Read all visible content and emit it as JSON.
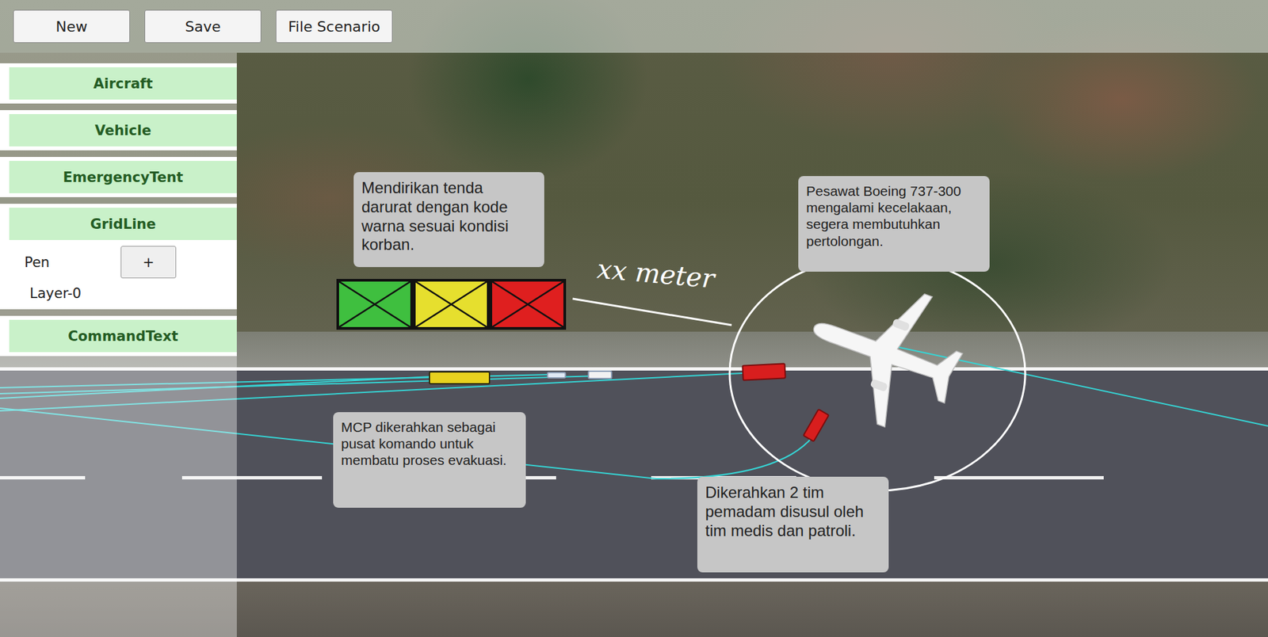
{
  "toolbar": {
    "buttons": [
      "New",
      "Save",
      "File Scenario"
    ]
  },
  "sidebar": {
    "items": [
      {
        "kind": "category",
        "label": "Aircraft"
      },
      {
        "kind": "category",
        "label": "Vehicle"
      },
      {
        "kind": "category",
        "label": "EmergencyTent"
      },
      {
        "kind": "category",
        "label": "GridLine"
      },
      {
        "kind": "tool",
        "label": "Pen",
        "button": "+"
      },
      {
        "kind": "layer",
        "label": "Layer-0"
      },
      {
        "kind": "category",
        "label": "CommandText"
      }
    ]
  },
  "callouts": [
    {
      "text": "Mendirikan tenda darurat dengan kode warna sesuai kondisi korban."
    },
    {
      "text": "Pesawat Boeing 737-300 mengalami kecelakaan, segera membutuhkan pertolongan."
    },
    {
      "text": "MCP dikerahkan sebagai pusat komando untuk membatu proses evakuasi."
    },
    {
      "text": "Dikerahkan 2 tim pemadam disusul oleh tim medis dan patroli."
    }
  ],
  "annotation": {
    "text": "xx meter"
  },
  "tents": [
    {
      "color": "#3fbf3f"
    },
    {
      "color": "#e6df2e"
    },
    {
      "color": "#df1f1f"
    }
  ],
  "vehicles": [
    {
      "kind": "bus",
      "color": "#e8d21e"
    },
    {
      "kind": "car",
      "color": "#dfe8f5"
    },
    {
      "kind": "car",
      "color": "#f2f2f2"
    },
    {
      "kind": "truck",
      "color": "#d81e1e"
    },
    {
      "kind": "truck",
      "color": "#d81e1e"
    }
  ]
}
